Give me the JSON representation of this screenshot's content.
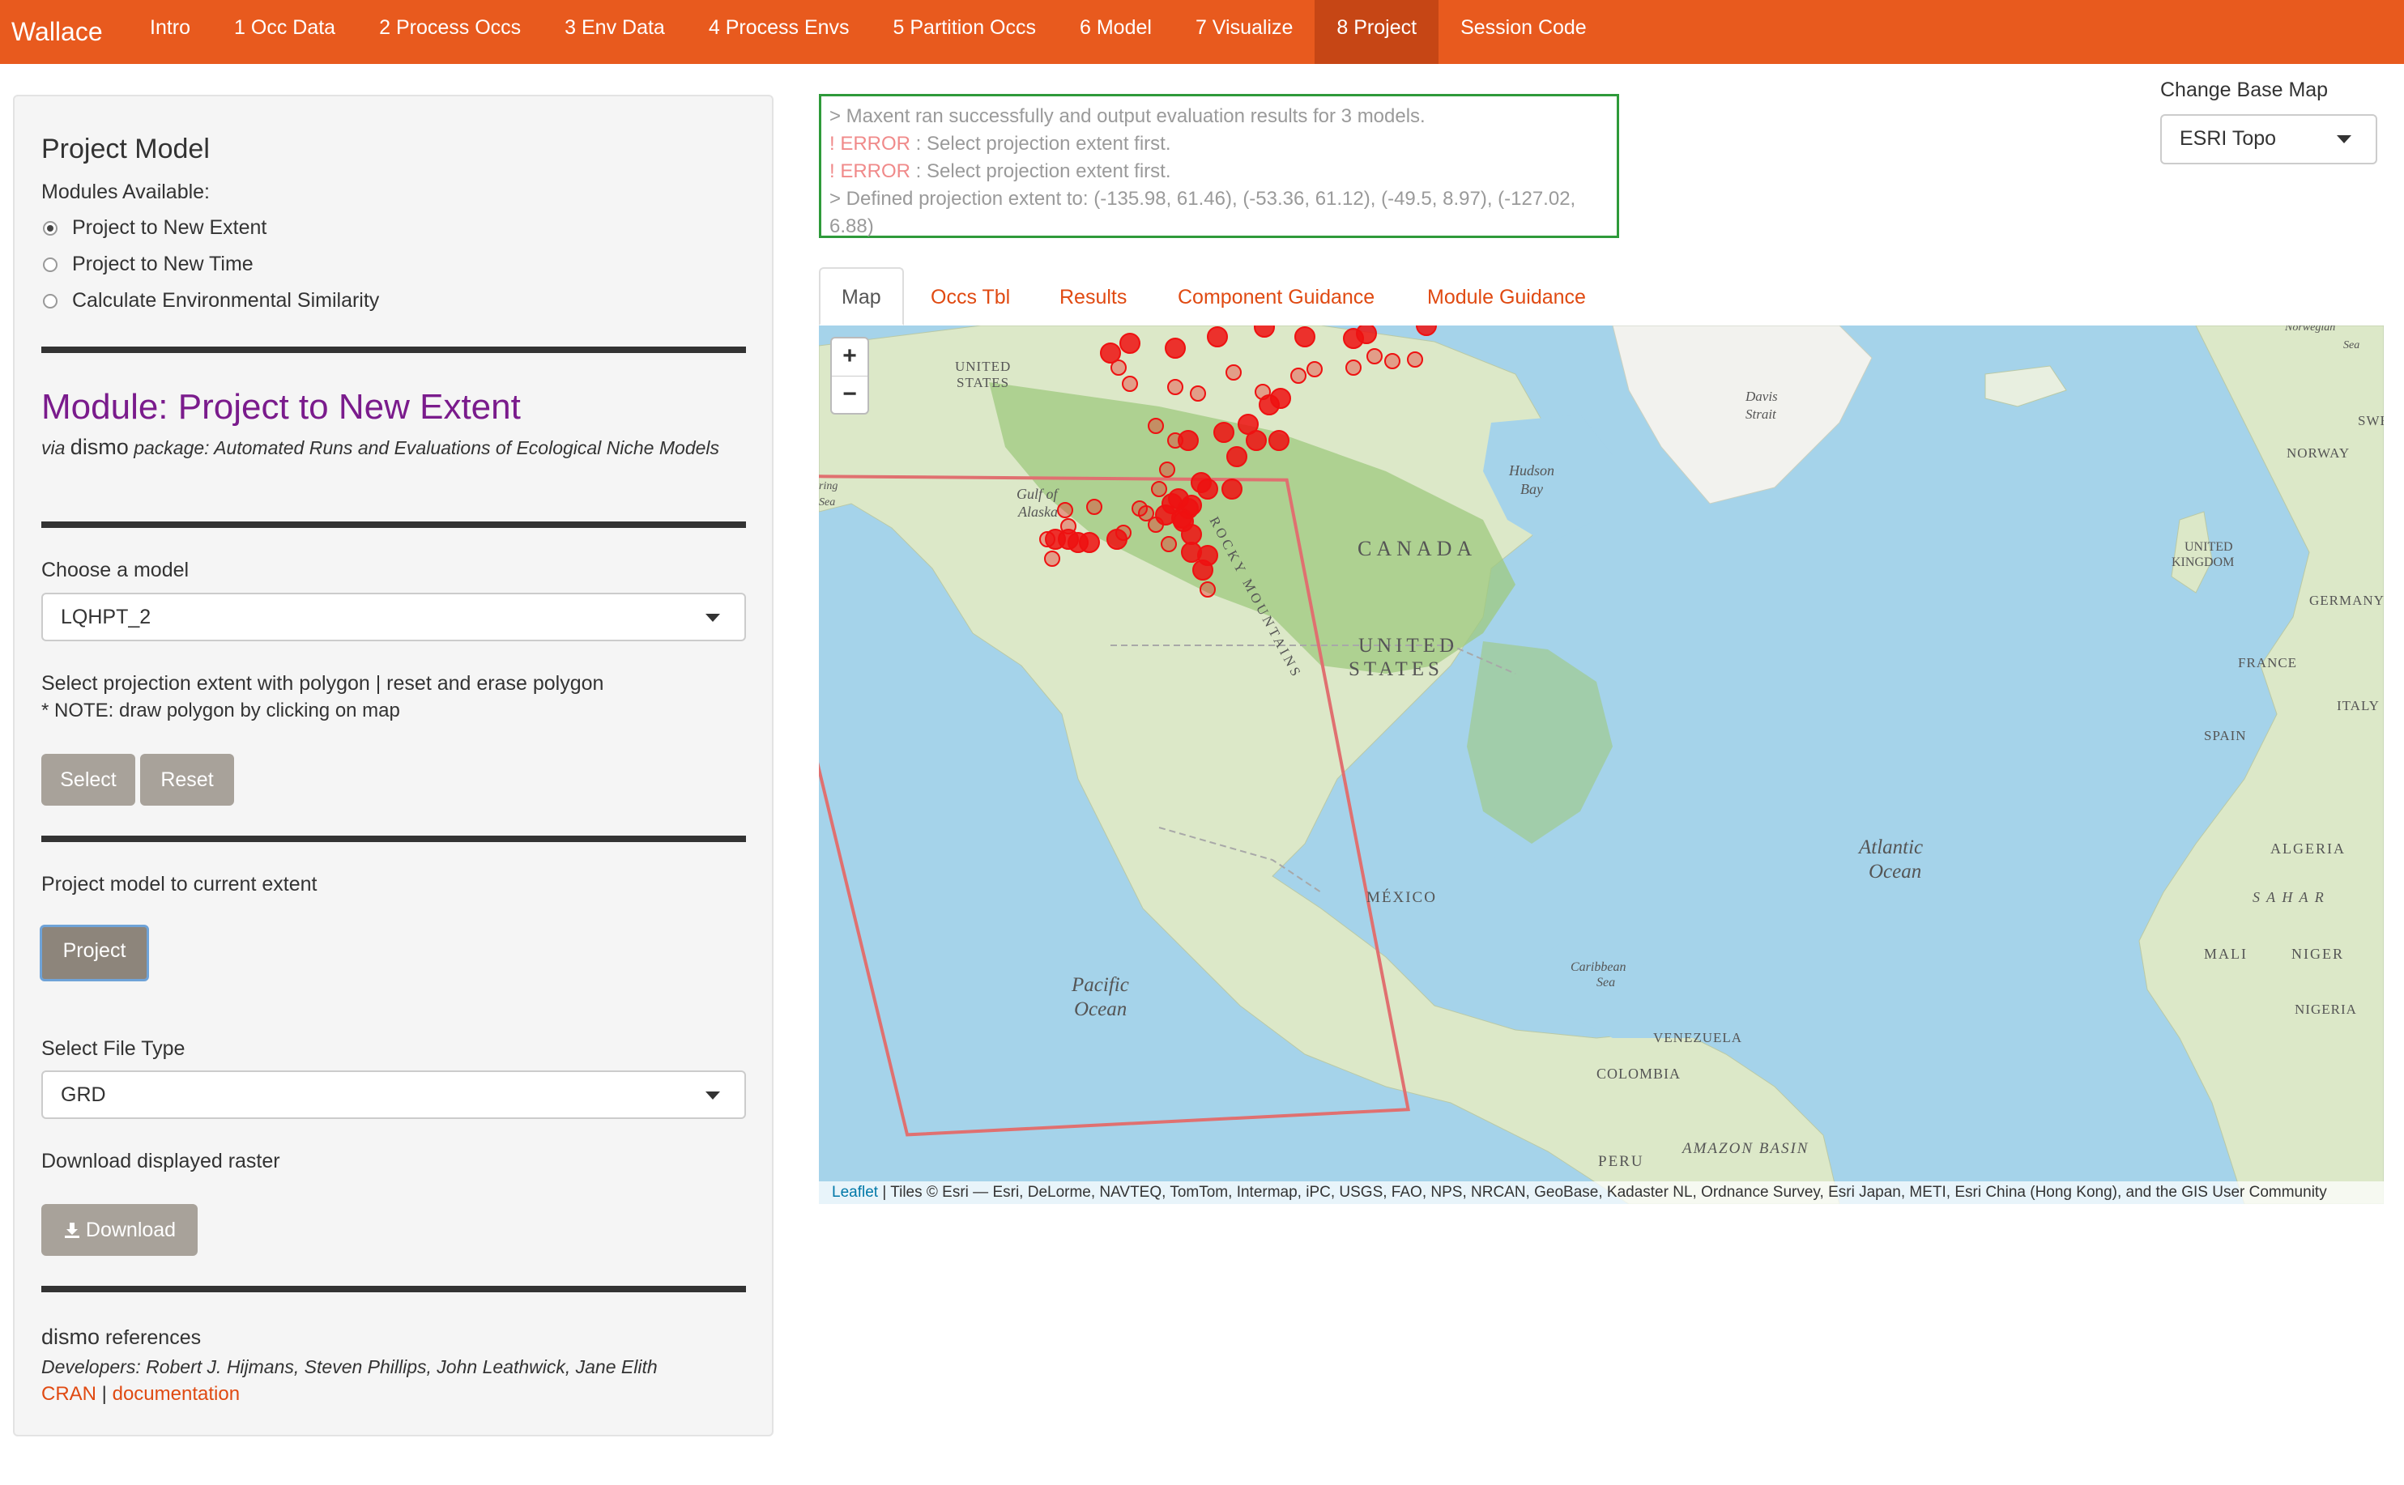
{
  "app": {
    "brand": "Wallace"
  },
  "nav": {
    "items": [
      {
        "label": "Intro"
      },
      {
        "label": "1 Occ Data"
      },
      {
        "label": "2 Process Occs"
      },
      {
        "label": "3 Env Data"
      },
      {
        "label": "4 Process Envs"
      },
      {
        "label": "5 Partition Occs"
      },
      {
        "label": "6 Model"
      },
      {
        "label": "7 Visualize"
      },
      {
        "label": "8 Project",
        "active": true
      },
      {
        "label": "Session Code"
      }
    ]
  },
  "sidebar": {
    "title": "Project Model",
    "modules_label": "Modules Available:",
    "modules": [
      {
        "label": "Project to New Extent",
        "selected": true
      },
      {
        "label": "Project to New Time",
        "selected": false
      },
      {
        "label": "Calculate Environmental Similarity",
        "selected": false
      }
    ],
    "module_title": "Module: Project to New Extent",
    "via": "via",
    "pkg": "dismo",
    "pkg_desc": " package: Automated Runs and Evaluations of Ecological Niche Models",
    "choose_model_label": "Choose a model",
    "model_value": "LQHPT_2",
    "extent_label": "Select projection extent with polygon | reset and erase polygon",
    "extent_note": "* NOTE: draw polygon by clicking on map",
    "select_btn": "Select",
    "reset_btn": "Reset",
    "project_label": "Project model to current extent",
    "project_btn": "Project",
    "filetype_label": "Select File Type",
    "filetype_value": "GRD",
    "download_label": "Download displayed raster",
    "download_btn": "Download",
    "refs_pkg": "dismo",
    "refs_label": " references",
    "developers": "Developers: Robert J. Hijmans, Steven Phillips, John Leathwick, Jane Elith",
    "cran": "CRAN",
    "sep": " | ",
    "documentation": "documentation"
  },
  "log": {
    "line1": "> Maxent ran successfully and output evaluation results for 3 models.",
    "err_prefix": "! ",
    "err_word": "ERROR",
    "err_msg": " : Select projection extent first.",
    "line4": "> Defined projection extent to: (-135.98, 61.46), (-53.36, 61.12), (-49.5, 8.97), (-127.02, 6.88)"
  },
  "basemap": {
    "label": "Change Base Map",
    "value": "ESRI Topo"
  },
  "tabs": [
    {
      "label": "Map",
      "active": true
    },
    {
      "label": "Occs Tbl"
    },
    {
      "label": "Results"
    },
    {
      "label": "Component Guidance"
    },
    {
      "label": "Module Guidance"
    }
  ],
  "map": {
    "zoom_in": "+",
    "zoom_out": "−",
    "labels": {
      "canada": "CANADA",
      "us_line1": "UNITED",
      "us_line2": "STATES",
      "mexico": "MÉXICO",
      "atlantic1": "Atlantic",
      "atlantic2": "Ocean",
      "pacific1": "Pacific",
      "pacific2": "Ocean",
      "hudson1": "Hudson",
      "hudson2": "Bay",
      "alaska1": "Gulf of",
      "alaska2": "Alaska",
      "us_top1": "UNITED",
      "us_top2": "STATES",
      "davis1": "Davis",
      "davis2": "Strait",
      "rocky": "ROCKY MOUNTAINS",
      "venezuela": "VENEZUELA",
      "colombia": "COLOMBIA",
      "peru": "PERU",
      "amazon": "AMAZON BASIN",
      "caribbean1": "Caribbean",
      "caribbean2": "Sea",
      "norway": "NORWAY",
      "swe": "SWE",
      "uk1": "UNITED",
      "uk2": "KINGDOM",
      "germany": "GERMANY",
      "france": "FRANCE",
      "italy": "ITALY",
      "spain": "SPAIN",
      "algeria": "ALGERIA",
      "sahara": "S A H A R",
      "mali": "MALI",
      "niger": "NIGER",
      "nigeria": "NIGERIA",
      "nsea1": "Norwegian",
      "nsea2": "Sea",
      "bering1": "ring",
      "bering2": "Sea"
    },
    "attribution_link": "Leaflet",
    "attribution_text": " | Tiles © Esri — Esri, DeLorme, NAVTEQ, TomTom, Intermap, iPC, USGS, FAO, NPS, NRCAN, GeoBase, Kadaster NL, Ordnance Survey, Esri Japan, METI, Esri China (Hong Kong), and the GIS User Community",
    "polygon": [
      [
        -135.98,
        61.46
      ],
      [
        -53.36,
        61.12
      ],
      [
        -49.5,
        8.97
      ],
      [
        -127.02,
        6.88
      ]
    ],
    "colors": {
      "water": "#a5d3ea",
      "land": "#dce8c8",
      "forest": "#9fca7f",
      "polygon": "#e07070",
      "points": "#ee1111"
    }
  }
}
